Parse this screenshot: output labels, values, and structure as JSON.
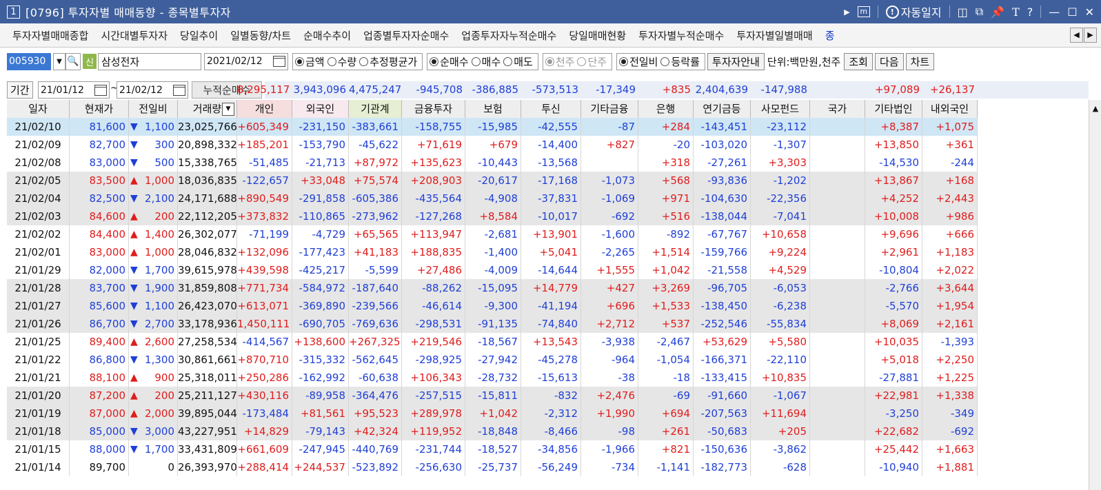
{
  "window": {
    "number": "1",
    "title": "[0796] 투자자별 매매동향 - 종목별투자자",
    "auto_journal": "자동일지"
  },
  "tabs": [
    "투자자별매매종합",
    "시간대별투자자",
    "당일추이",
    "일별동향/차트",
    "순매수추이",
    "업종별투자자순매수",
    "업종투자자누적순매수",
    "당일매매현황",
    "투자자별누적순매수",
    "투자자별일별매매",
    "종"
  ],
  "controls": {
    "stock_code": "005930",
    "badge": "신",
    "stock_name": "삼성전자",
    "date": "2021/02/12",
    "radio_amount": [
      {
        "label": "금액",
        "checked": true
      },
      {
        "label": "수량",
        "checked": false
      },
      {
        "label": "추정평균가",
        "checked": false
      }
    ],
    "radio_trade": [
      {
        "label": "순매수",
        "checked": true
      },
      {
        "label": "매수",
        "checked": false
      },
      {
        "label": "매도",
        "checked": false
      }
    ],
    "radio_unit": [
      {
        "label": "천주",
        "checked": true
      },
      {
        "label": "단주",
        "checked": false
      }
    ],
    "radio_compare": [
      {
        "label": "전일비",
        "checked": true
      },
      {
        "label": "등락률",
        "checked": false
      }
    ],
    "guide_button": "투자자안내",
    "unit_label": "단위:백만원,천주",
    "query_button": "조회",
    "next_button": "다음",
    "chart_button": "차트"
  },
  "period": {
    "label": "기간",
    "from": "21/01/12",
    "to": "21/02/12",
    "cum_label": "누적순매수",
    "sums": [
      "8,295,117",
      "3,943,096",
      "4,475,247",
      "-945,708",
      "-386,885",
      "-573,513",
      "-17,349",
      "+835",
      "2,404,639",
      "-147,988",
      "",
      "+97,089",
      "+26,137"
    ]
  },
  "columns": [
    "일자",
    "현재가",
    "전일비",
    "거래량",
    "개인",
    "외국인",
    "기관계",
    "금융투자",
    "보험",
    "투신",
    "기타금융",
    "은행",
    "연기금등",
    "사모펀드",
    "국가",
    "기타법인",
    "내외국인"
  ],
  "rows": [
    {
      "date": "21/02/10",
      "price": "81,600",
      "dir": "down",
      "diff": "1,100",
      "vol": "23,025,766",
      "v": [
        "+605,349",
        "-231,150",
        "-383,661",
        "-158,755",
        "-15,985",
        "-42,555",
        "-87",
        "+284",
        "-143,451",
        "-23,112",
        "",
        "+8,387",
        "+1,075"
      ]
    },
    {
      "date": "21/02/09",
      "price": "82,700",
      "dir": "down",
      "diff": "300",
      "vol": "20,898,332",
      "v": [
        "+185,201",
        "-153,790",
        "-45,622",
        "+71,619",
        "+679",
        "-14,400",
        "+827",
        "-20",
        "-103,020",
        "-1,307",
        "",
        "+13,850",
        "+361"
      ]
    },
    {
      "date": "21/02/08",
      "price": "83,000",
      "dir": "down",
      "diff": "500",
      "vol": "15,338,765",
      "v": [
        "-51,485",
        "-21,713",
        "+87,972",
        "+135,623",
        "-10,443",
        "-13,568",
        "",
        "+318",
        "-27,261",
        "+3,303",
        "",
        "-14,530",
        "-244"
      ]
    },
    {
      "date": "21/02/05",
      "price": "83,500",
      "dir": "up",
      "diff": "1,000",
      "vol": "18,036,835",
      "v": [
        "-122,657",
        "+33,048",
        "+75,574",
        "+208,903",
        "-20,617",
        "-17,168",
        "-1,073",
        "+568",
        "-93,836",
        "-1,202",
        "",
        "+13,867",
        "+168"
      ]
    },
    {
      "date": "21/02/04",
      "price": "82,500",
      "dir": "down",
      "diff": "2,100",
      "vol": "24,171,688",
      "v": [
        "+890,549",
        "-291,858",
        "-605,386",
        "-435,564",
        "-4,908",
        "-37,831",
        "-1,069",
        "+971",
        "-104,630",
        "-22,356",
        "",
        "+4,252",
        "+2,443"
      ]
    },
    {
      "date": "21/02/03",
      "price": "84,600",
      "dir": "up",
      "diff": "200",
      "vol": "22,112,205",
      "v": [
        "+373,832",
        "-110,865",
        "-273,962",
        "-127,268",
        "+8,584",
        "-10,017",
        "-692",
        "+516",
        "-138,044",
        "-7,041",
        "",
        "+10,008",
        "+986"
      ]
    },
    {
      "date": "21/02/02",
      "price": "84,400",
      "dir": "up",
      "diff": "1,400",
      "vol": "26,302,077",
      "v": [
        "-71,199",
        "-4,729",
        "+65,565",
        "+113,947",
        "-2,681",
        "+13,901",
        "-1,600",
        "-892",
        "-67,767",
        "+10,658",
        "",
        "+9,696",
        "+666"
      ]
    },
    {
      "date": "21/02/01",
      "price": "83,000",
      "dir": "up",
      "diff": "1,000",
      "vol": "28,046,832",
      "v": [
        "+132,096",
        "-177,423",
        "+41,183",
        "+188,835",
        "-1,400",
        "+5,041",
        "-2,265",
        "+1,514",
        "-159,766",
        "+9,224",
        "",
        "+2,961",
        "+1,183"
      ]
    },
    {
      "date": "21/01/29",
      "price": "82,000",
      "dir": "down",
      "diff": "1,700",
      "vol": "39,615,978",
      "v": [
        "+439,598",
        "-425,217",
        "-5,599",
        "+27,486",
        "-4,009",
        "-14,644",
        "+1,555",
        "+1,042",
        "-21,558",
        "+4,529",
        "",
        "-10,804",
        "+2,022"
      ]
    },
    {
      "date": "21/01/28",
      "price": "83,700",
      "dir": "down",
      "diff": "1,900",
      "vol": "31,859,808",
      "v": [
        "+771,734",
        "-584,972",
        "-187,640",
        "-88,262",
        "-15,095",
        "+14,779",
        "+427",
        "+3,269",
        "-96,705",
        "-6,053",
        "",
        "-2,766",
        "+3,644"
      ]
    },
    {
      "date": "21/01/27",
      "price": "85,600",
      "dir": "down",
      "diff": "1,100",
      "vol": "26,423,070",
      "v": [
        "+613,071",
        "-369,890",
        "-239,566",
        "-46,614",
        "-9,300",
        "-41,194",
        "+696",
        "+1,533",
        "-138,450",
        "-6,238",
        "",
        "-5,570",
        "+1,954"
      ]
    },
    {
      "date": "21/01/26",
      "price": "86,700",
      "dir": "down",
      "diff": "2,700",
      "vol": "33,178,936",
      "v": [
        "1,450,111",
        "-690,705",
        "-769,636",
        "-298,531",
        "-91,135",
        "-74,840",
        "+2,712",
        "+537",
        "-252,546",
        "-55,834",
        "",
        "+8,069",
        "+2,161"
      ]
    },
    {
      "date": "21/01/25",
      "price": "89,400",
      "dir": "up",
      "diff": "2,600",
      "vol": "27,258,534",
      "v": [
        "-414,567",
        "+138,600",
        "+267,325",
        "+219,546",
        "-18,567",
        "+13,543",
        "-3,938",
        "-2,467",
        "+53,629",
        "+5,580",
        "",
        "+10,035",
        "-1,393"
      ]
    },
    {
      "date": "21/01/22",
      "price": "86,800",
      "dir": "down",
      "diff": "1,300",
      "vol": "30,861,661",
      "v": [
        "+870,710",
        "-315,332",
        "-562,645",
        "-298,925",
        "-27,942",
        "-45,278",
        "-964",
        "-1,054",
        "-166,371",
        "-22,110",
        "",
        "+5,018",
        "+2,250"
      ]
    },
    {
      "date": "21/01/21",
      "price": "88,100",
      "dir": "up",
      "diff": "900",
      "vol": "25,318,011",
      "v": [
        "+250,286",
        "-162,992",
        "-60,638",
        "+106,343",
        "-28,732",
        "-15,613",
        "-38",
        "-18",
        "-133,415",
        "+10,835",
        "",
        "-27,881",
        "+1,225"
      ]
    },
    {
      "date": "21/01/20",
      "price": "87,200",
      "dir": "up",
      "diff": "200",
      "vol": "25,211,127",
      "v": [
        "+430,116",
        "-89,958",
        "-364,476",
        "-257,515",
        "-15,811",
        "-832",
        "+2,476",
        "-69",
        "-91,660",
        "-1,067",
        "",
        "+22,981",
        "+1,338"
      ]
    },
    {
      "date": "21/01/19",
      "price": "87,000",
      "dir": "up",
      "diff": "2,000",
      "vol": "39,895,044",
      "v": [
        "-173,484",
        "+81,561",
        "+95,523",
        "+289,978",
        "+1,042",
        "-2,312",
        "+1,990",
        "+694",
        "-207,563",
        "+11,694",
        "",
        "-3,250",
        "-349"
      ]
    },
    {
      "date": "21/01/18",
      "price": "85,000",
      "dir": "down",
      "diff": "3,000",
      "vol": "43,227,951",
      "v": [
        "+14,829",
        "-79,143",
        "+42,324",
        "+119,952",
        "-18,848",
        "-8,466",
        "-98",
        "+261",
        "-50,683",
        "+205",
        "",
        "+22,682",
        "-692"
      ]
    },
    {
      "date": "21/01/15",
      "price": "88,000",
      "dir": "down",
      "diff": "1,700",
      "vol": "33,431,809",
      "v": [
        "+661,609",
        "-247,945",
        "-440,769",
        "-231,744",
        "-18,527",
        "-34,856",
        "-1,966",
        "+821",
        "-150,636",
        "-3,862",
        "",
        "+25,442",
        "+1,663"
      ]
    },
    {
      "date": "21/01/14",
      "price": "89,700",
      "dir": "none",
      "diff": "0",
      "vol": "26,393,970",
      "v": [
        "+288,414",
        "+244,537",
        "-523,892",
        "-256,630",
        "-25,737",
        "-56,249",
        "-734",
        "-1,141",
        "-182,773",
        "-628",
        "",
        "-10,940",
        "+1,881"
      ]
    }
  ],
  "colors": {
    "title_bar": "#3f5f9c",
    "positive": "#e01c1c",
    "negative": "#1f3fd6",
    "selected_row": "#cfe6f5",
    "gray_row": "#e6e6e6",
    "header_individual": "#f6dede",
    "header_foreign": "#f7e9ee",
    "header_institution": "#e6efd3"
  }
}
